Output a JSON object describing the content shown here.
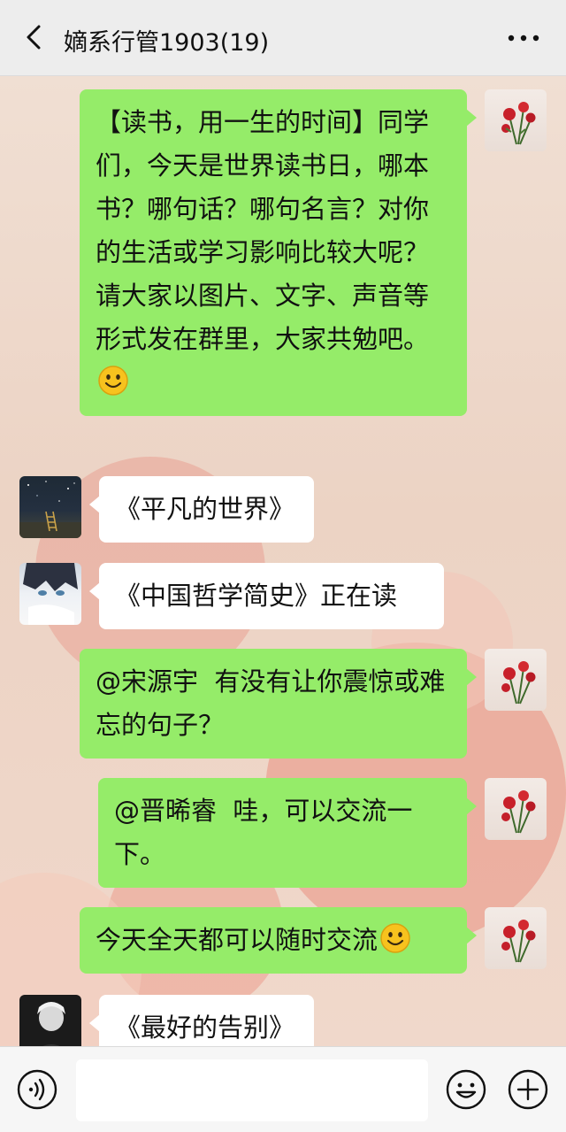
{
  "header": {
    "title": "嫡系行管1903(19)",
    "back_icon": "chevron-left-icon",
    "more_icon": "more-dots-icon"
  },
  "messages": [
    {
      "side": "right",
      "avatar": "roses-avatar",
      "text": "【读书，用一生的时间】同学们，今天是世界读书日，哪本书？哪句话？哪句名言？对你的生活或学习影响比较大呢？\n请大家以图片、文字、声音等形式发在群里，大家共勉吧。",
      "emoji": "smiley-emoji"
    },
    {
      "side": "left",
      "avatar": "night-sky-avatar",
      "text": "《平凡的世界》"
    },
    {
      "side": "left",
      "avatar": "anime-boy-avatar",
      "text": "《中国哲学简史》正在读"
    },
    {
      "side": "right",
      "avatar": "roses-avatar",
      "text": "@宋源宇  有没有让你震惊或难忘的句子？"
    },
    {
      "side": "right",
      "avatar": "roses-avatar",
      "text": "@晋晞睿  哇，可以交流一下。"
    },
    {
      "side": "right",
      "avatar": "roses-avatar",
      "text": "今天全天都可以随时交流",
      "emoji": "smiley-emoji"
    },
    {
      "side": "left",
      "avatar": "dark-portrait-avatar",
      "text": "《最好的告别》"
    }
  ],
  "inputbar": {
    "input_value": "",
    "voice_icon": "voice-icon",
    "emoji_icon": "emoji-icon",
    "add_icon": "plus-icon"
  },
  "colors": {
    "sent_bubble": "#95ec69",
    "received_bubble": "#ffffff",
    "header_bg": "#ededed"
  }
}
